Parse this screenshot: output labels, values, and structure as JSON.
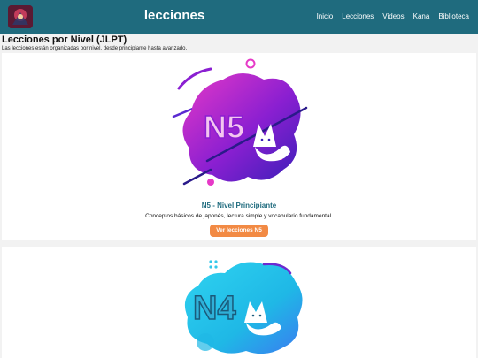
{
  "header": {
    "site_title": "lecciones",
    "nav": [
      "Inicio",
      "Lecciones",
      "Videos",
      "Kana",
      "Biblioteca"
    ]
  },
  "page": {
    "heading": "Lecciones por Nivel (JLPT)",
    "subtitle": "Las lecciones están organizadas por nivel, desde principiante hasta avanzado."
  },
  "levels": [
    {
      "badge_text": "N5",
      "title": "N5 - Nivel Principiante",
      "description": "Conceptos básicos de japonés, lectura simple y vocabulario fundamental.",
      "button_label": "Ver lecciones N5"
    },
    {
      "badge_text": "N4"
    }
  ],
  "colors": {
    "header_bg": "#1f6b7e",
    "accent_title": "#1f6b7e",
    "button_bg": "#f28a44",
    "n5_primary": "#8a1fd1",
    "n5_accent": "#e639c7",
    "n4_primary": "#1fb8e6",
    "n4_accent": "#3a7bf0"
  }
}
